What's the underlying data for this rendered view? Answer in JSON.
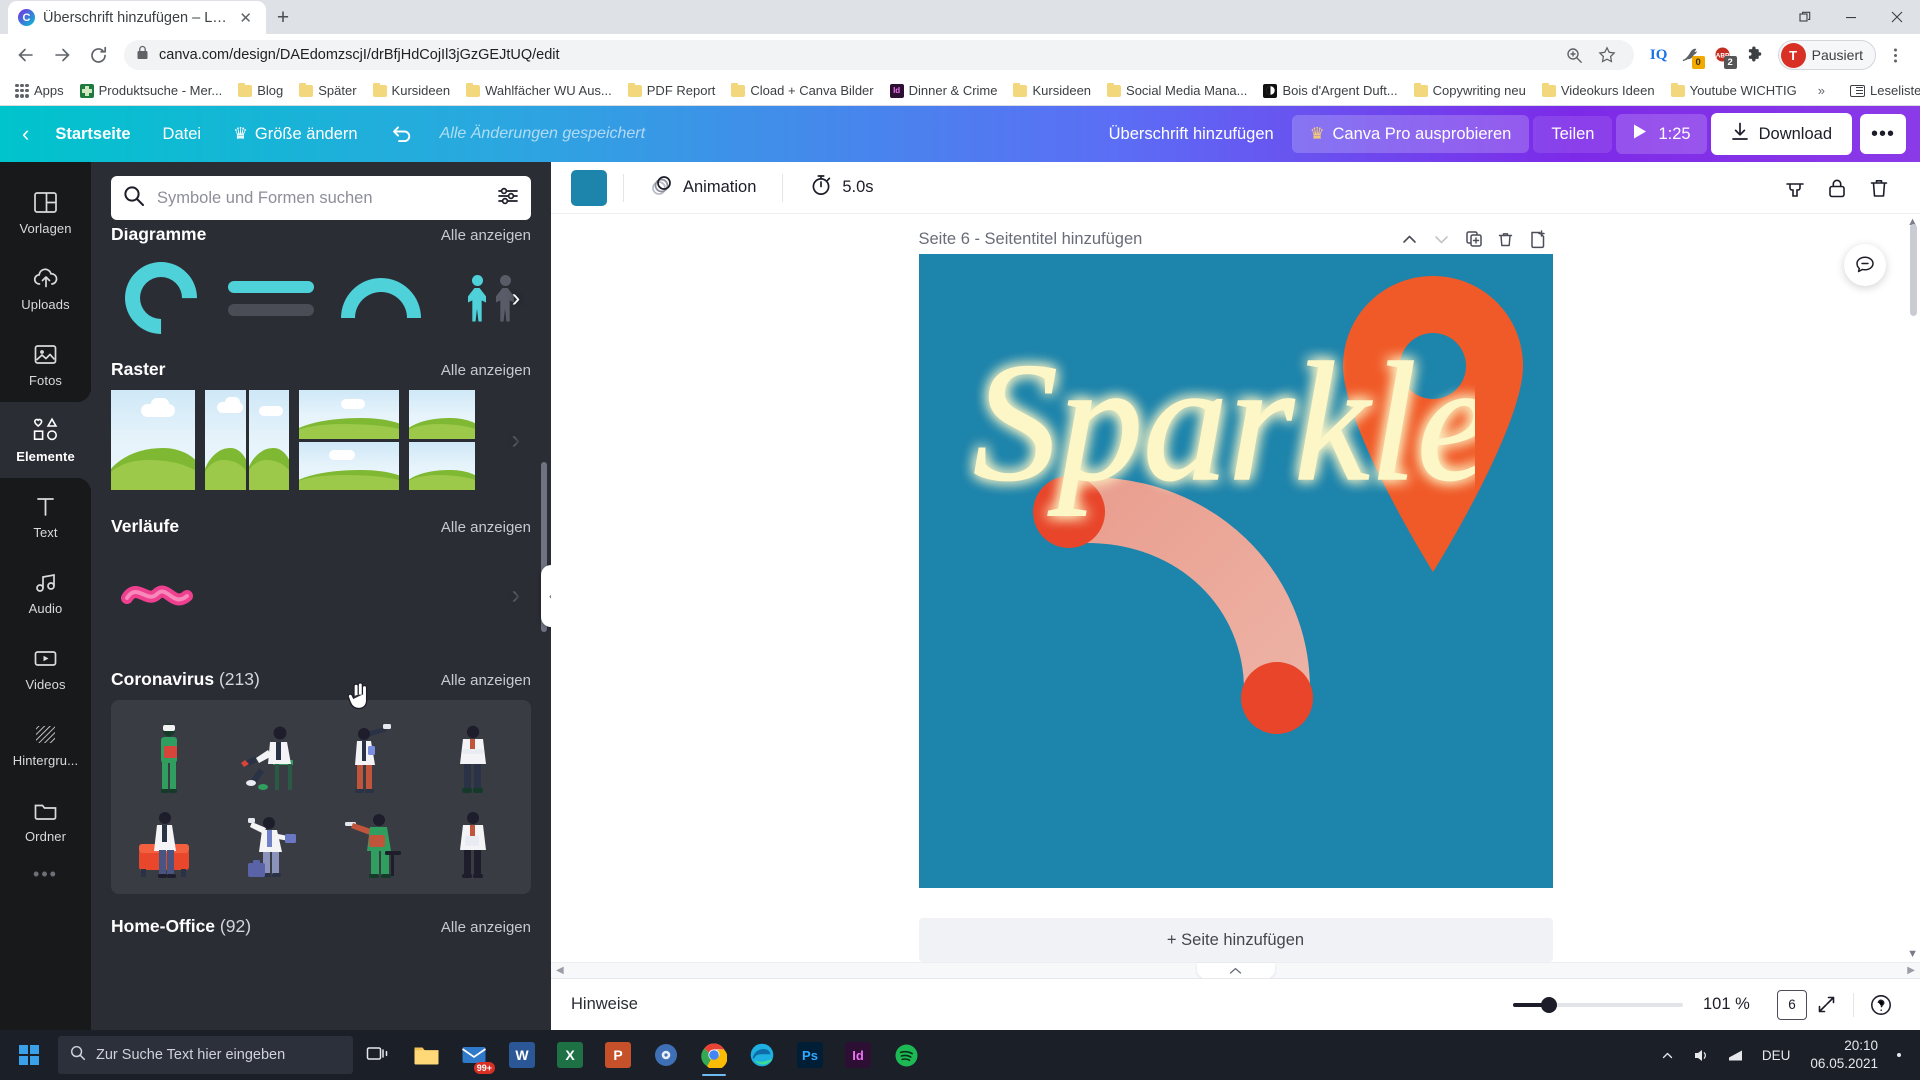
{
  "browser": {
    "tab": {
      "title": "Überschrift hinzufügen – Logo",
      "favicon_letter": "C",
      "close_icon": "close-icon"
    },
    "new_tab_label": "+",
    "window_controls": {
      "minimize": "—",
      "maximize": "▢",
      "close": "✕",
      "restore_icon": "restore-icon"
    },
    "nav": {
      "back": "←",
      "forward": "→",
      "reload": "⟳"
    },
    "omnibox": {
      "url": "canva.com/design/DAEdomzscjI/drBfjHdCojIl3jGzGEJtUQ/edit",
      "lock_icon": "lock-icon",
      "zoom_icon": "zoom-search-icon",
      "star_icon": "bookmark-star-icon"
    },
    "extensions": [
      {
        "name": "iq-extension",
        "label": "IQ",
        "badge": null
      },
      {
        "name": "bird-extension",
        "label": "",
        "badge": "0"
      },
      {
        "name": "adblock-plus-extension",
        "label": "ABP",
        "badge": "2"
      },
      {
        "name": "extensions-puzzle",
        "label": "",
        "badge": null
      }
    ],
    "profile": {
      "initial": "T",
      "label": "Pausiert"
    },
    "menu_icon": "chrome-menu-kebab-icon",
    "bookmarks": [
      {
        "label": "Apps",
        "icon": "apps-grid-icon"
      },
      {
        "label": "Produktsuche - Mer...",
        "icon": "site-icon-green"
      },
      {
        "label": "Blog",
        "icon": "folder-icon"
      },
      {
        "label": "Später",
        "icon": "folder-icon"
      },
      {
        "label": "Kursideen",
        "icon": "folder-icon"
      },
      {
        "label": "Wahlfächer WU Aus...",
        "icon": "folder-icon"
      },
      {
        "label": "PDF Report",
        "icon": "folder-icon"
      },
      {
        "label": "Cload + Canva Bilder",
        "icon": "folder-icon"
      },
      {
        "label": "Dinner & Crime",
        "icon": "site-icon-indesign"
      },
      {
        "label": "Kursideen",
        "icon": "folder-icon"
      },
      {
        "label": "Social Media Mana...",
        "icon": "folder-icon"
      },
      {
        "label": "Bois d'Argent Duft...",
        "icon": "site-icon-dark"
      },
      {
        "label": "Copywriting neu",
        "icon": "folder-icon"
      },
      {
        "label": "Videokurs Ideen",
        "icon": "folder-icon"
      },
      {
        "label": "Youtube WICHTIG",
        "icon": "folder-icon"
      }
    ],
    "bookmarks_overflow": "»",
    "reading_list": {
      "label": "Leseliste",
      "icon": "reading-list-icon"
    }
  },
  "canva": {
    "topbar": {
      "back_icon": "chevron-left-icon",
      "home": "Startseite",
      "file": "Datei",
      "resize": "Größe ändern",
      "resize_crown_icon": "crown-icon",
      "undo_icon": "undo-arrow-icon",
      "saved_status": "Alle Änderungen gespeichert",
      "design_title": "Überschrift hinzufügen",
      "pro_label": "Canva Pro ausprobieren",
      "pro_crown_icon": "crown-icon",
      "share": "Teilen",
      "play_icon": "play-triangle-icon",
      "duration": "1:25",
      "download": "Download",
      "download_icon": "download-arrow-icon",
      "more": "•••"
    },
    "rail": [
      {
        "label": "Vorlagen",
        "icon": "templates-icon",
        "active": false
      },
      {
        "label": "Uploads",
        "icon": "upload-cloud-icon",
        "active": false
      },
      {
        "label": "Fotos",
        "icon": "photo-icon",
        "active": false
      },
      {
        "label": "Elemente",
        "icon": "shapes-icon",
        "active": true
      },
      {
        "label": "Text",
        "icon": "text-t-icon",
        "active": false
      },
      {
        "label": "Audio",
        "icon": "music-note-icon",
        "active": false
      },
      {
        "label": "Videos",
        "icon": "video-play-icon",
        "active": false
      },
      {
        "label": "Hintergru...",
        "icon": "background-hatch-icon",
        "active": false
      },
      {
        "label": "Ordner",
        "icon": "folder-icon",
        "active": false
      }
    ],
    "rail_more": "•••",
    "panel": {
      "search": {
        "placeholder": "Symbole und Formen suchen",
        "value": "",
        "search_icon": "search-icon",
        "filter_icon": "sliders-filter-icon"
      },
      "see_all": "Alle anzeigen",
      "next_arrow": "›",
      "sections": [
        {
          "title": "Diagramme",
          "count": "",
          "see_all": "Alle anzeigen"
        },
        {
          "title": "Raster",
          "count": "",
          "see_all": "Alle anzeigen"
        },
        {
          "title": "Verläufe",
          "count": "",
          "see_all": "Alle anzeigen"
        },
        {
          "title": "Coronavirus",
          "count": "(213)",
          "see_all": "Alle anzeigen"
        },
        {
          "title": "Home-Office",
          "count": "(92)",
          "see_all": "Alle anzeigen"
        }
      ],
      "collapse_icon": "panel-collapse-chevron-icon"
    },
    "editor_toolbar": {
      "color_swatch_hex": "#1d84ab",
      "animation_label": "Animation",
      "animation_icon": "animation-circles-icon",
      "duration_label": "5.0s",
      "duration_icon": "stopwatch-icon",
      "copy_style_icon": "copy-style-icon",
      "lock_icon": "lock-icon",
      "trash_icon": "trash-icon"
    },
    "page": {
      "header": "Seite 6 - Seitentitel hinzufügen",
      "up_icon": "chevron-up-icon",
      "down_icon": "chevron-down-icon",
      "duplicate_icon": "duplicate-page-icon",
      "delete_icon": "trash-icon",
      "add_page_icon": "add-page-icon",
      "background_hex": "#1d84ab",
      "artwork_text": "Sparkle",
      "add_page_label": "+ Seite hinzufügen",
      "comment_icon": "comment-bubble-icon"
    },
    "statusbar": {
      "notes_label": "Hinweise",
      "zoom_percent": "101 %",
      "page_number": "6",
      "fullscreen_icon": "expand-arrows-icon",
      "help_icon": "help-question-icon",
      "collapse_icon": "chevron-up-icon"
    }
  },
  "taskbar": {
    "start_icon": "windows-start-icon",
    "search_placeholder": "Zur Suche Text hier eingeben",
    "search_icon": "search-icon",
    "task_view_icon": "task-view-icon",
    "apps": [
      {
        "name": "file-explorer",
        "label": "",
        "icon": "folder-icon",
        "badge": null
      },
      {
        "name": "mail",
        "label": "",
        "icon": "mail-icon",
        "badge": "99+"
      },
      {
        "name": "word",
        "label": "W",
        "icon": "word-icon",
        "badge": null
      },
      {
        "name": "excel",
        "label": "X",
        "icon": "excel-icon",
        "badge": null
      },
      {
        "name": "powerpoint",
        "label": "P",
        "icon": "powerpoint-icon",
        "badge": null
      },
      {
        "name": "media-player",
        "label": "",
        "icon": "disc-icon",
        "badge": null
      },
      {
        "name": "chrome",
        "label": "",
        "icon": "chrome-icon",
        "badge": null
      },
      {
        "name": "edge",
        "label": "",
        "icon": "edge-icon",
        "badge": null
      },
      {
        "name": "photoshop",
        "label": "",
        "icon": "photoshop-icon",
        "badge": null
      },
      {
        "name": "indesign",
        "label": "Id",
        "icon": "indesign-icon",
        "badge": null
      },
      {
        "name": "spotify",
        "label": "",
        "icon": "spotify-icon",
        "badge": null
      }
    ],
    "tray": {
      "overflow_icon": "chevron-up-icon",
      "volume_icon": "volume-icon",
      "network_icon": "network-icon",
      "language": "DEU",
      "time": "20:10",
      "date": "06.05.2021",
      "notification_icon": "notification-dot-icon"
    }
  }
}
